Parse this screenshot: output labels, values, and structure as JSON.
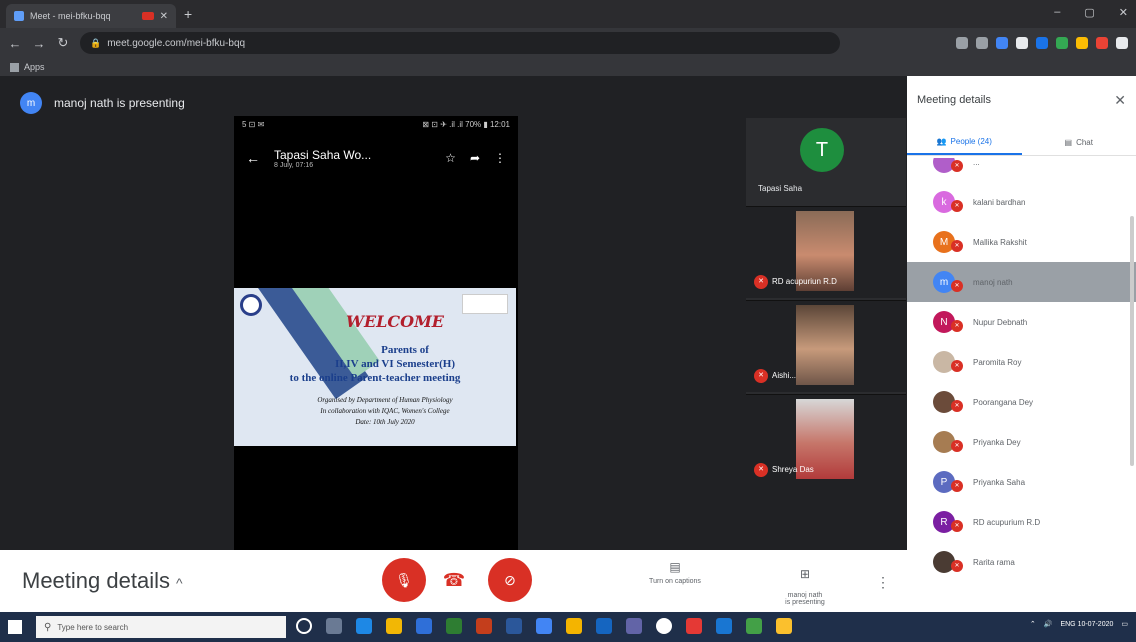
{
  "browser": {
    "tab_title": "Meet - mei-bfku-bqq",
    "new_tab": "+",
    "url": "meet.google.com/mei-bfku-bqq",
    "bookmark_apps": "Apps",
    "window_controls": [
      "–",
      "▢",
      "✕"
    ]
  },
  "meet": {
    "presenting_text": "manoj nath is presenting",
    "presenter_initial": "m",
    "phone": {
      "status_left": "5 ⊡ ✉",
      "status_right": "⊠ ⊡ ✈ .il .il 70% ▮ 12:01",
      "chat_title": "Tapasi Saha Wo...",
      "chat_subtitle": "8 July, 07:16"
    },
    "slide": {
      "welcome": "WELCOME",
      "line1": "Parents of",
      "line2": "II,IV and VI Semester(H)",
      "line3": "to the online Parent-teacher meeting",
      "line4": "Organised by Department of Human Physiology",
      "line5": "In collaboration with IQAC, Women's College",
      "line6": "Date: 10th July 2020"
    },
    "tiles": {
      "main_initial": "T",
      "main_name": "Tapasi Saha",
      "video": [
        {
          "name": "RD acupuriun R.D"
        },
        {
          "name": "Aishi..."
        },
        {
          "name": "Shreya Das"
        }
      ]
    }
  },
  "panel": {
    "header": "Meeting details",
    "tab_people": "People (24)",
    "tab_chat": "Chat",
    "people": [
      {
        "initial": "",
        "name": "...",
        "color": "#b05ec9"
      },
      {
        "initial": "k",
        "name": "kalani bardhan",
        "color": "#d96adf"
      },
      {
        "initial": "M",
        "name": "Mallika Rakshit",
        "color": "#e8711c"
      },
      {
        "initial": "m",
        "name": "manoj nath",
        "color": "#4285f4"
      },
      {
        "initial": "N",
        "name": "Nupur Debnath",
        "color": "#c2185b"
      },
      {
        "initial": "",
        "name": "Paromita Roy",
        "color": "#c9b7a4"
      },
      {
        "initial": "",
        "name": "Poorangana Dey",
        "color": "#6b4b3a"
      },
      {
        "initial": "",
        "name": "Priyanka Dey",
        "color": "#a67c52"
      },
      {
        "initial": "P",
        "name": "Priyanka Saha",
        "color": "#5c6bc0"
      },
      {
        "initial": "R",
        "name": "RD acupurium R.D",
        "color": "#7b1fa2"
      },
      {
        "initial": "",
        "name": "Rarita rama",
        "color": "#4a3b33"
      }
    ]
  },
  "bottom": {
    "meeting_details": "Meeting details",
    "captions": "Turn on captions",
    "presenting": "manoj nath\nis presenting"
  },
  "taskbar": {
    "search_placeholder": "Type here to search",
    "tray_text": "ENG 10-07-2020"
  }
}
